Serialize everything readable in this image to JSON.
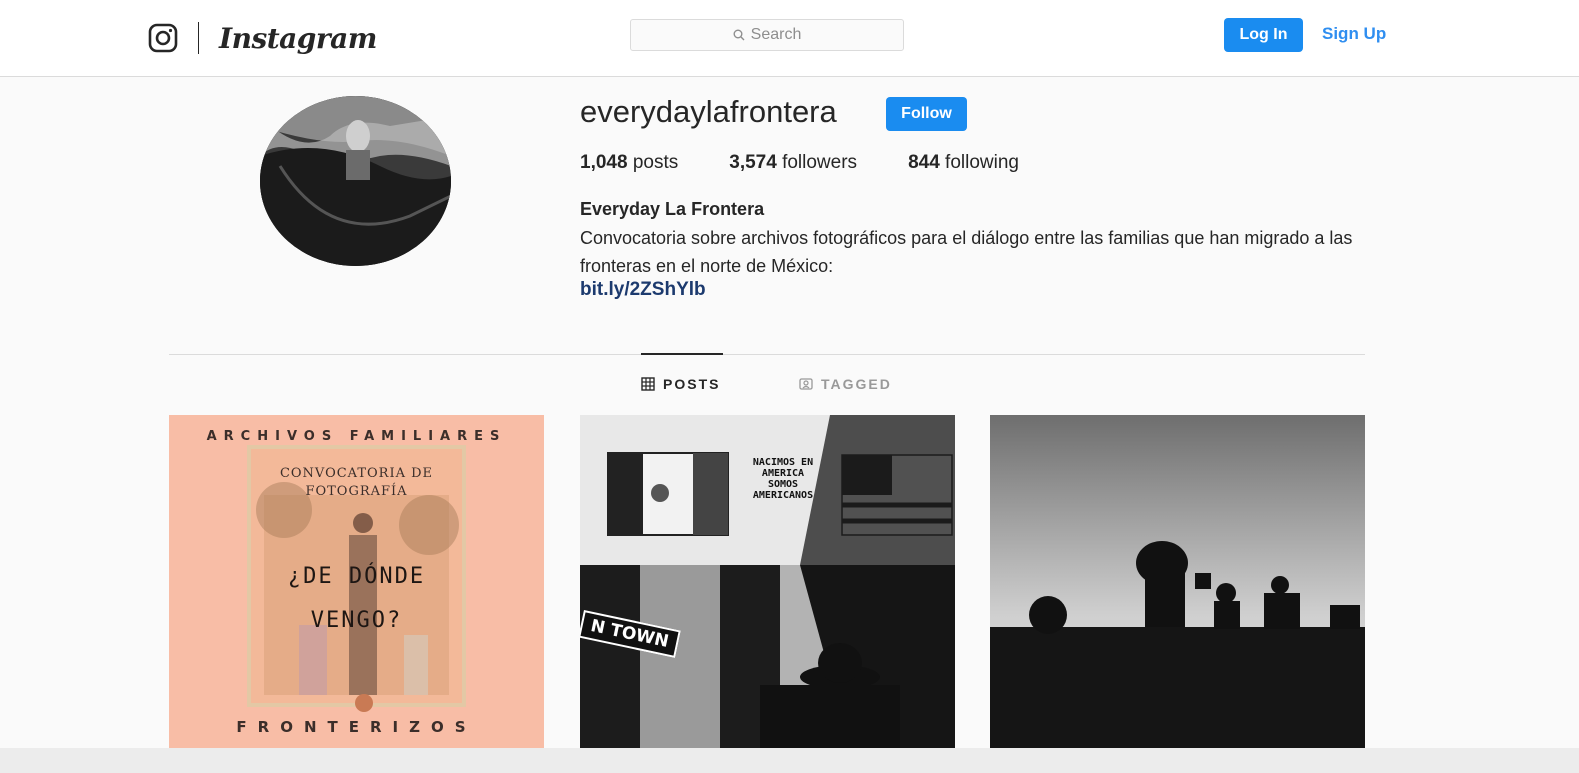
{
  "header": {
    "wordmark": "Instagram",
    "search_placeholder": "Search",
    "login_label": "Log In",
    "signup_label": "Sign Up"
  },
  "profile": {
    "username": "everydaylafrontera",
    "follow_label": "Follow",
    "posts_count": "1,048",
    "posts_label": "posts",
    "followers_count": "3,574",
    "followers_label": "followers",
    "following_count": "844",
    "following_label": "following",
    "full_name": "Everyday La Frontera",
    "bio": "Convocatoria sobre archivos fotográficos para el diálogo entre las familias que han migrado a las fronteras en el norte de México:",
    "link": "bit.ly/2ZShYlb"
  },
  "tabs": [
    {
      "label": "POSTS",
      "icon": "grid-icon",
      "active": true
    },
    {
      "label": "TAGGED",
      "icon": "tagged-icon",
      "active": false
    }
  ],
  "posts": [
    {
      "top_text": "ARCHIVOS FAMILIARES",
      "convocatoria": "CONVOCATORIA DE FOTOGRAFÍA",
      "question": "¿DE DÓNDE VENGO?",
      "bottom_text": "FRONTERIZOS"
    },
    {
      "sign_text": "NACIMOS EN AMERICA SOMOS AMERICANOS",
      "street_sign": "N TOWN"
    },
    {}
  ],
  "colors": {
    "accent": "#1a8cf0",
    "link": "#1c3a6e",
    "post1_bg": "#f8bda6"
  }
}
